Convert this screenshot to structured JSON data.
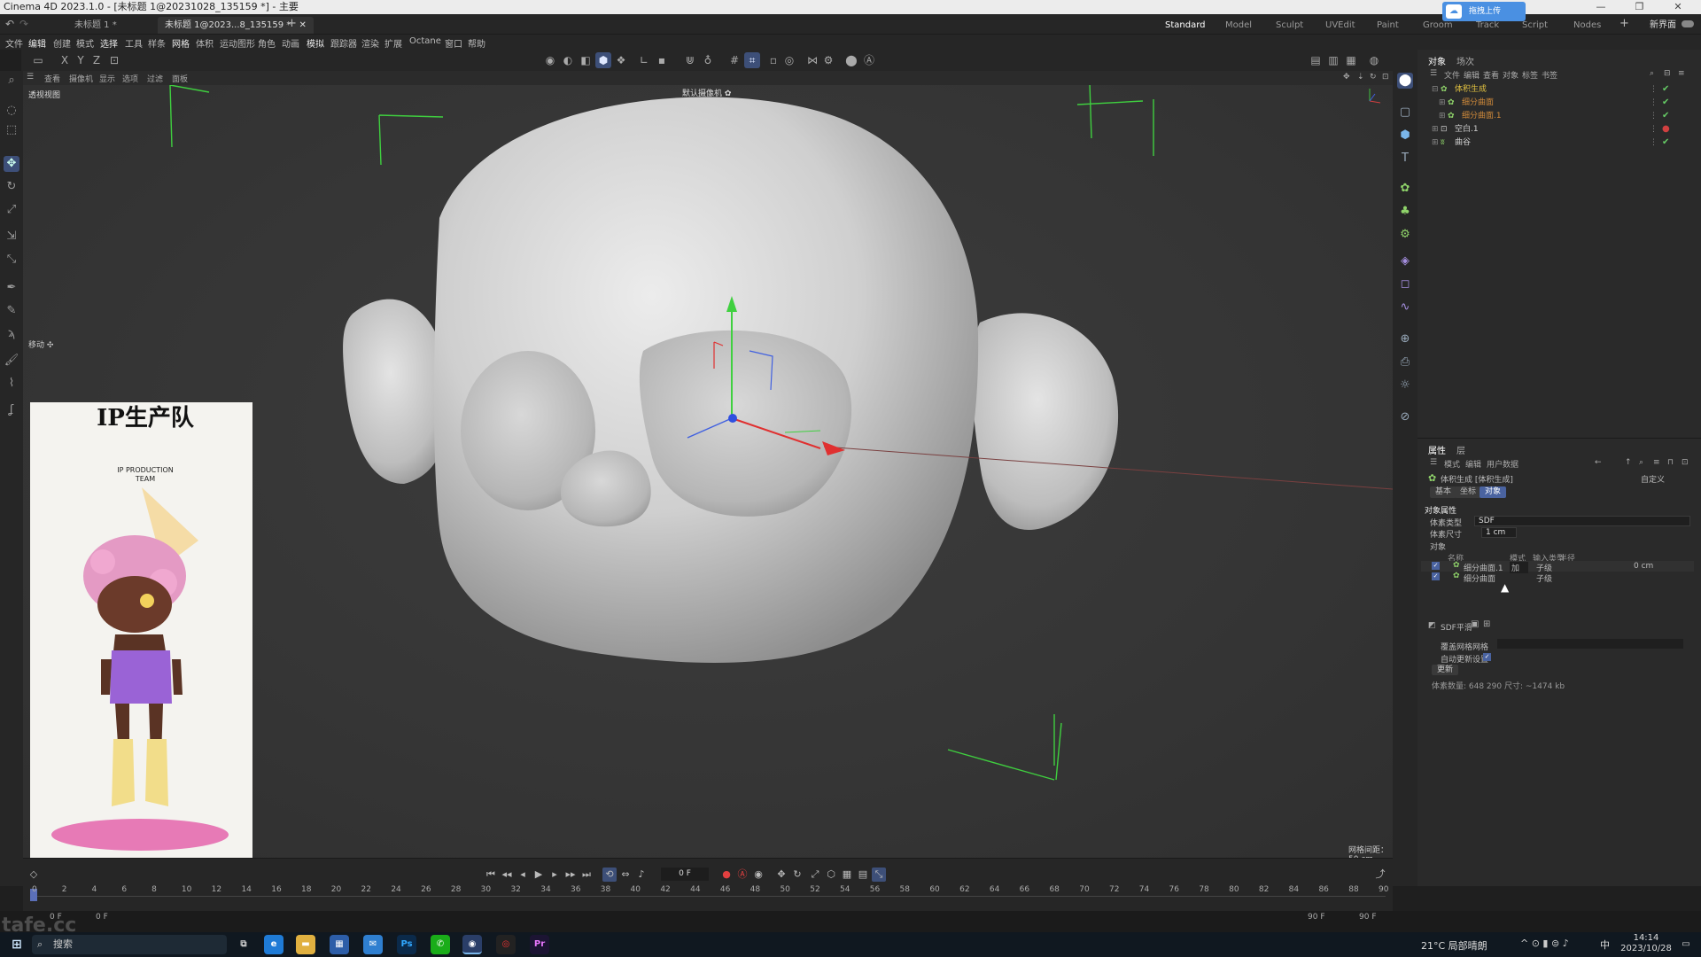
{
  "window": {
    "title": "Cinema 4D 2023.1.0 - [未标题 1@20231028_135159 *] - 主要",
    "controls": [
      "—",
      "❐",
      "✕"
    ]
  },
  "doc_tabs": [
    "未标题 1 *",
    "未标题 1@2023...8_135159 *"
  ],
  "upload_badge": "拖拽上传",
  "layout_tabs": [
    "Standard",
    "Model",
    "Sculpt",
    "UVEdit",
    "Paint",
    "Groom",
    "Track",
    "Script",
    "Nodes"
  ],
  "new_layout": "新界面",
  "menu": [
    "文件",
    "编辑",
    "创建",
    "模式",
    "选择",
    "工具",
    "样条",
    "网格",
    "体积",
    "运动图形",
    "角色",
    "动画",
    "模拟",
    "跟踪器",
    "渲染",
    "扩展",
    "Octane",
    "窗口",
    "帮助"
  ],
  "axis_buttons": [
    "X",
    "Y",
    "Z"
  ],
  "viewport": {
    "menu": [
      "查看",
      "摄像机",
      "显示",
      "选项",
      "过滤",
      "面板"
    ],
    "name": "透视视图",
    "camera_label": "默认摄像机 ✿",
    "move_label": "移动 ✣",
    "grid_spacing": "网格间距：50 cm"
  },
  "ref_image": {
    "logo_main": "IP生产队",
    "logo_sub1": "IP PRODUCTION",
    "logo_sub2": "TEAM"
  },
  "object_panel": {
    "tabs": [
      "对象",
      "场次"
    ],
    "menu": [
      "文件",
      "编辑",
      "查看",
      "对象",
      "标签",
      "书签"
    ],
    "items": [
      {
        "name": "体积生成",
        "color": "#e0c040",
        "check": "✔"
      },
      {
        "name": "细分曲面",
        "color": "#d08a3a",
        "check": "✔"
      },
      {
        "name": "细分曲面.1",
        "color": "#d08a3a",
        "check": "✔"
      },
      {
        "name": "空白.1",
        "color": "#cfcfcf",
        "check": "●"
      },
      {
        "name": "曲谷",
        "color": "#cfcfcf",
        "check": "✔"
      }
    ]
  },
  "attr_panel": {
    "tabs": [
      "属性",
      "层"
    ],
    "menu": [
      "模式",
      "编辑",
      "用户数据"
    ],
    "object_title": "体积生成 [体积生成]",
    "preset": "自定义",
    "mode_tabs": [
      "基本",
      "坐标",
      "对象"
    ],
    "section": "对象属性",
    "volume_type_label": "体素类型",
    "volume_type_value": "SDF",
    "voxel_size_label": "体素尺寸",
    "voxel_size_value": "1 cm",
    "objects_label": "对象",
    "table_headers": [
      "名称",
      "模式",
      "输入类型",
      "半径"
    ],
    "table_rows": [
      {
        "name": "细分曲面.1",
        "mode": "加",
        "type": "子级",
        "radius": "0 cm"
      },
      {
        "name": "细分曲面",
        "mode": "",
        "type": "子级",
        "radius": ""
      }
    ],
    "sdf_smooth": "SDF平滑",
    "cover_label": "覆盖网格网格",
    "auto_update": "自动更新设置",
    "update_btn": "更新",
    "voxel_info": "体素数量: 648 290  尺寸: ~1474 kb"
  },
  "timeline": {
    "frame": "0 F",
    "start": "0 F",
    "start2": "0 F",
    "end": "90 F",
    "end2": "90 F",
    "ticks": [
      "0",
      "2",
      "4",
      "6",
      "8",
      "10",
      "12",
      "14",
      "16",
      "18",
      "20",
      "22",
      "24",
      "26",
      "28",
      "30",
      "32",
      "34",
      "36",
      "38",
      "40",
      "42",
      "44",
      "46",
      "48",
      "50",
      "52",
      "54",
      "56",
      "58",
      "60",
      "62",
      "64",
      "66",
      "68",
      "70",
      "72",
      "74",
      "76",
      "78",
      "80",
      "82",
      "84",
      "86",
      "88",
      "90"
    ]
  },
  "taskbar": {
    "search": "搜索",
    "weather": "21°C 局部晴朗",
    "time": "14:14",
    "date": "2023/10/28",
    "ime": "中",
    "watermark": "tafe.cc"
  }
}
